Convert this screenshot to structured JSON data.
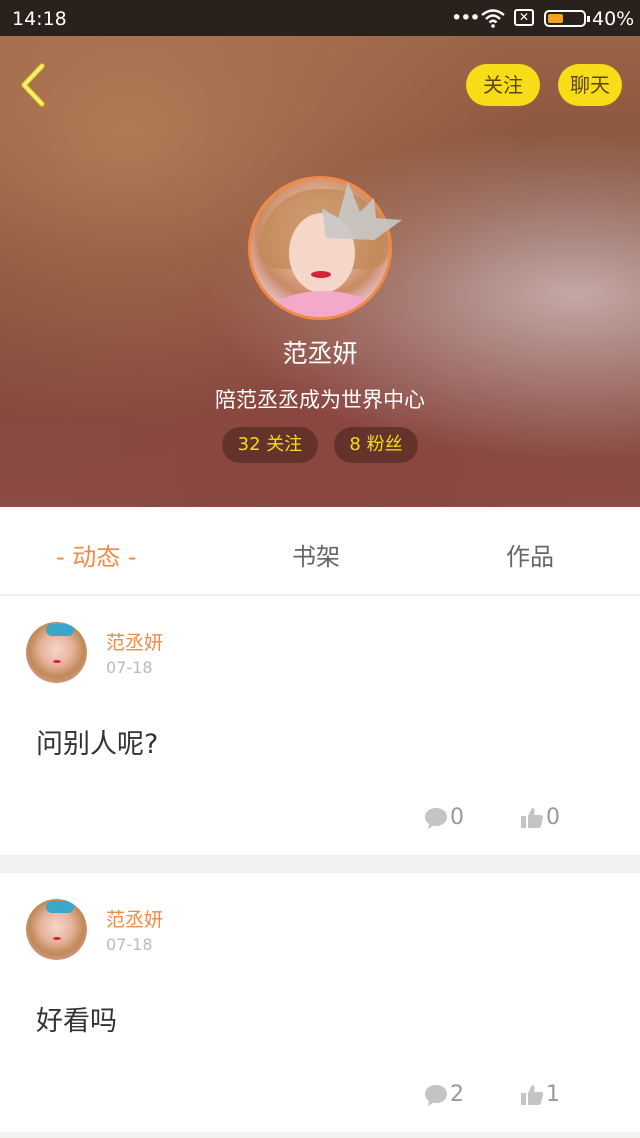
{
  "status_bar": {
    "time": "14:18",
    "dots": "•••",
    "battery_percent": "40%",
    "battery_level": 0.4
  },
  "header": {
    "follow_label": "关注",
    "chat_label": "聊天",
    "username": "范丞妍",
    "signature": "陪范丞丞成为世界中心",
    "following_text": "32 关注",
    "fans_text": "8 粉丝"
  },
  "tabs": [
    {
      "label": "- 动态 -",
      "active": true
    },
    {
      "label": "书架",
      "active": false
    },
    {
      "label": "作品",
      "active": false
    }
  ],
  "posts": [
    {
      "author": "范丞妍",
      "date": "07-18",
      "text": "问别人呢?",
      "comments": "0",
      "likes": "0"
    },
    {
      "author": "范丞妍",
      "date": "07-18",
      "text": "好看吗",
      "comments": "2",
      "likes": "1"
    }
  ],
  "colors": {
    "accent": "#f08a45",
    "button_yellow": "#f7dd17",
    "stat_yellow": "#f7dd17"
  },
  "icons": [
    "back-arrow-icon",
    "wifi-icon",
    "sim-icon",
    "battery-icon",
    "crown-icon",
    "comment-icon",
    "like-icon"
  ]
}
